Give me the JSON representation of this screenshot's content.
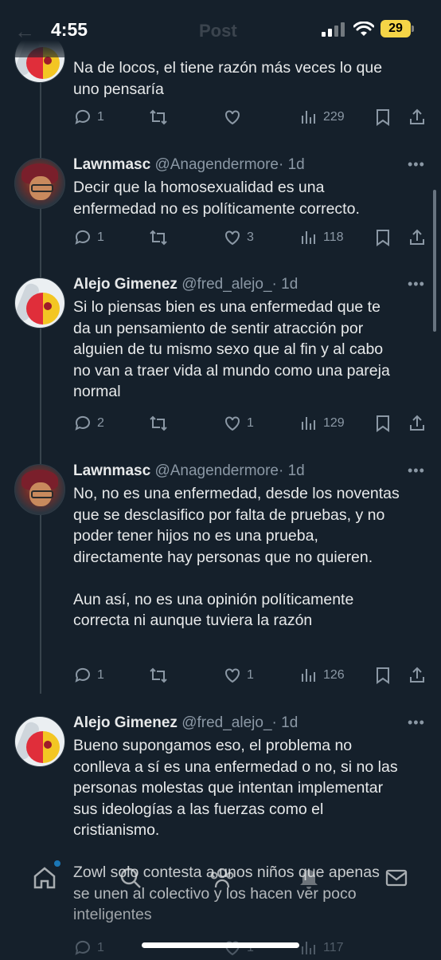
{
  "status_bar": {
    "time": "4:55",
    "battery": "29"
  },
  "header": {
    "back_icon": "arrow-left-icon",
    "title": "Post"
  },
  "tweets": [
    {
      "name": "",
      "handle": "",
      "time": "",
      "text": "Na de locos, el tiene razón más veces lo que uno pensaría",
      "replies": "1",
      "retweets": "",
      "likes": "",
      "views": "229"
    },
    {
      "name": "Lawnmasc",
      "handle": "@Anagendermore",
      "time": "· 1d",
      "text": "Decir que la homosexualidad es una enfermedad no es políticamente correcto.",
      "replies": "1",
      "retweets": "",
      "likes": "3",
      "views": "118"
    },
    {
      "name": "Alejo Gimenez",
      "handle": "@fred_alejo_",
      "time": "· 1d",
      "text": "Si lo piensas bien es una enfermedad que te da un pensamiento de sentir atracción por alguien de tu mismo sexo que al fin y al cabo no van a traer vida al mundo como una pareja normal",
      "replies": "2",
      "retweets": "",
      "likes": "1",
      "views": "129"
    },
    {
      "name": "Lawnmasc",
      "handle": "@Anagendermore",
      "time": "· 1d",
      "text": "No, no es una enfermedad, desde los noventas que se desclasifico por falta de pruebas, y no poder tener hijos no es una prueba, directamente hay personas que no quieren.\n\nAun así, no es una opinión políticamente correcta ni aunque tuviera la razón",
      "replies": "1",
      "retweets": "",
      "likes": "1",
      "views": "126"
    },
    {
      "name": "Alejo Gimenez",
      "handle": "@fred_alejo_",
      "time": "· 1d",
      "text": "Bueno supongamos eso, el problema no conlleva a sí es una enfermedad o no, si no las personas molestas que intentan implementar sus ideologías a las fuerzas como el cristianismo.\n\nZowl solo contesta a unos niños que apenas se unen al colectivo y los hacen ver poco inteligentes",
      "replies": "1",
      "retweets": "",
      "likes": "1",
      "views": "117"
    }
  ],
  "more_label": "•••",
  "tabbar": {
    "items": [
      "home-icon",
      "search-icon",
      "communities-icon",
      "notifications-icon",
      "messages-icon"
    ]
  },
  "colors": {
    "background": "#15202b",
    "text": "#e7e9ea",
    "secondary": "#8b98a5",
    "accent": "#1d9bf0"
  }
}
